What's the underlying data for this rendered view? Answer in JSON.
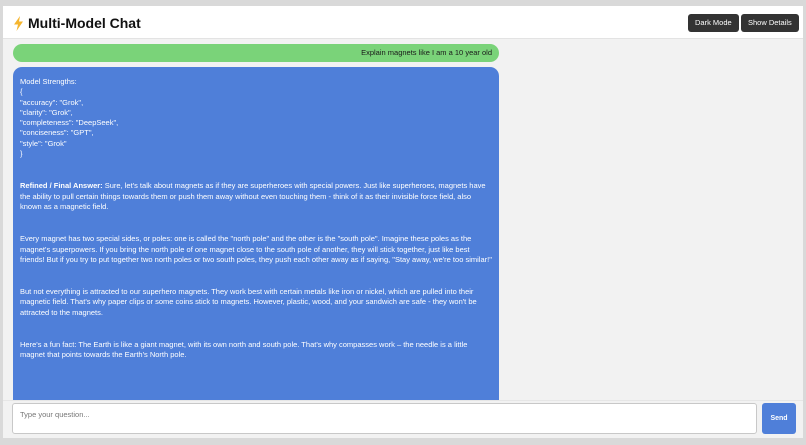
{
  "app": {
    "title": "Multi-Model Chat",
    "icon": "lightning-bolt-icon"
  },
  "header": {
    "dark_mode_label": "Dark Mode",
    "show_details_label": "Show Details"
  },
  "user_message": "Explain magnets like I am a 10 year old",
  "bot_message": {
    "strengths_heading": "Model Strengths:",
    "strengths_lines": [
      "{",
      "\"accuracy\": \"Grok\",",
      "\"clarity\": \"Grok\",",
      "\"completeness\": \"DeepSeek\",",
      "\"conciseness\": \"GPT\",",
      "\"style\": \"Grok\"",
      "}"
    ],
    "final_label": "Refined / Final Answer:",
    "final_intro": " Sure, let's talk about magnets as if they are superheroes with special powers. Just like superheroes, magnets have the ability to pull certain things towards them or push them away without even touching them - think of it as their invisible force field, also known as a magnetic field.",
    "paragraphs": [
      "Every magnet has two special sides, or poles: one is called the \"north pole\" and the other is the \"south pole\". Imagine these poles as the magnet's superpowers. If you bring the north pole of one magnet close to the south pole of another, they will stick together, just like best friends! But if you try to put together two north poles or two south poles, they push each other away as if saying, \"Stay away, we're too similar!\"",
      "But not everything is attracted to our superhero magnets. They work best with certain metals like iron or nickel, which are pulled into their magnetic field. That's why paper clips or some coins stick to magnets. However, plastic, wood, and your sandwich are safe - they won't be attracted to the magnets.",
      "Here's a fun fact: The Earth is like a giant magnet, with its own north and south pole. That's why compasses work – the needle is a little magnet that points towards the Earth's North pole."
    ]
  },
  "input": {
    "placeholder": "Type your question...",
    "value": ""
  },
  "send_label": "Send",
  "colors": {
    "user_bubble": "#7ad379",
    "bot_bubble": "#4f7fd9",
    "header_button": "#333333",
    "send_button": "#4f7fd9"
  }
}
